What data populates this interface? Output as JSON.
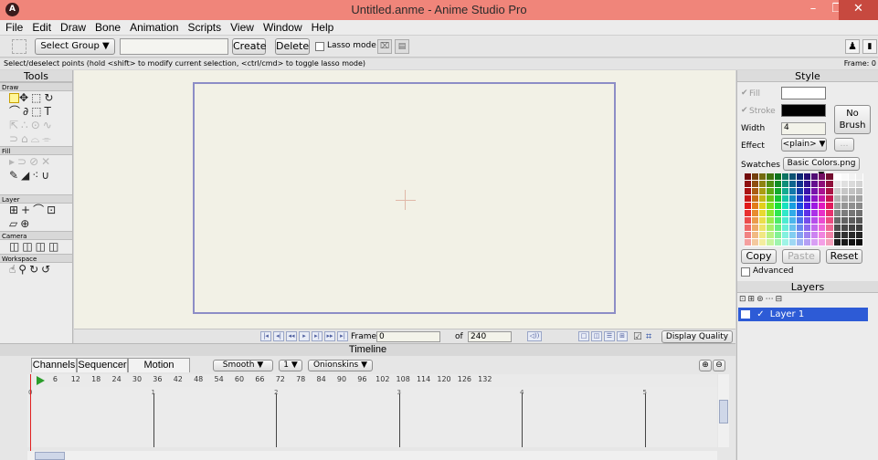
{
  "window": {
    "title": "Untitled.anme - Anime Studio Pro",
    "app_icon": "anime-studio-icon"
  },
  "menu": [
    "File",
    "Edit",
    "Draw",
    "Bone",
    "Animation",
    "Scripts",
    "View",
    "Window",
    "Help"
  ],
  "toolbar": {
    "select_group": "Select Group",
    "name_value": "",
    "create": "Create",
    "delete": "Delete",
    "lasso_mode": "Lasso mode"
  },
  "status": {
    "hint": "Select/deselect points (hold <shift> to modify current selection, <ctrl/cmd> to toggle lasso mode)",
    "frame_label": "Frame: 0"
  },
  "tools": {
    "title": "Tools",
    "sections": {
      "draw": "Draw",
      "fill": "Fill",
      "layer": "Layer",
      "camera": "Camera",
      "workspace": "Workspace"
    }
  },
  "playback": {
    "frame_label": "Frame",
    "frame_value": "0",
    "of_label": "of",
    "total_frames": "240",
    "display_quality": "Display Quality"
  },
  "style": {
    "title": "Style",
    "fill": "Fill",
    "stroke": "Stroke",
    "width_label": "Width",
    "width_value": "4",
    "effect_label": "Effect",
    "effect_value": "<plain>",
    "no_brush": "No Brush",
    "swatches_label": "Swatches",
    "swatches_value": "Basic Colors.png",
    "copy": "Copy",
    "paste": "Paste",
    "reset": "Reset",
    "advanced": "Advanced",
    "fill_color": "#ffffff",
    "stroke_color": "#000000"
  },
  "layers": {
    "title": "Layers",
    "items": [
      {
        "name": "Layer 1"
      }
    ]
  },
  "timeline": {
    "title": "Timeline",
    "tabs": [
      "Channels",
      "Sequencer",
      "Motion Graph"
    ],
    "smooth": "Smooth",
    "step": "1",
    "onionskins": "Onionskins",
    "ruler_ticks": [
      "0",
      "6",
      "12",
      "18",
      "24",
      "30",
      "36",
      "42",
      "48",
      "54",
      "60",
      "66",
      "72",
      "78",
      "84",
      "90",
      "96",
      "102",
      "108",
      "114",
      "120",
      "126",
      "132"
    ],
    "markers": [
      "0",
      "1",
      "2",
      "3",
      "4",
      "5"
    ]
  }
}
